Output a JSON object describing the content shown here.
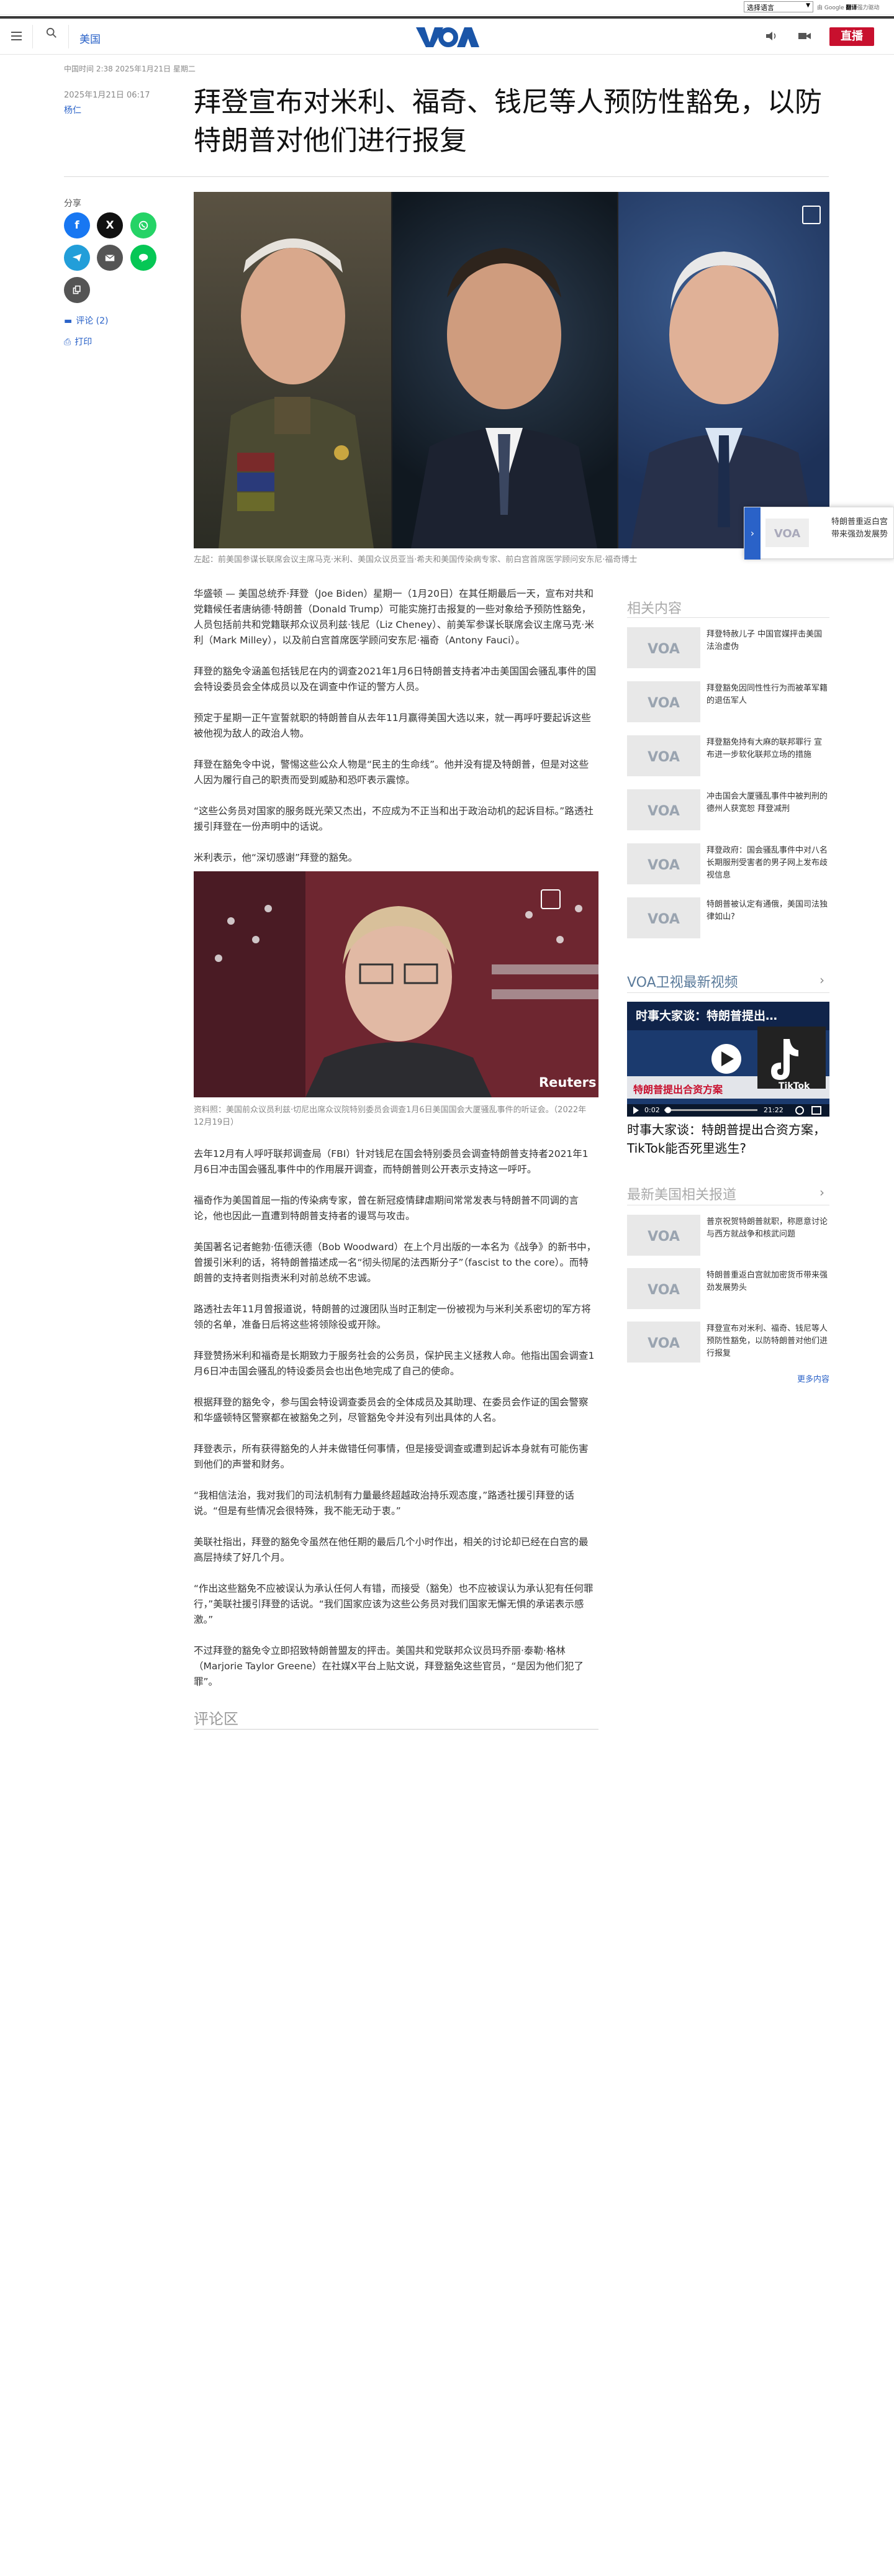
{
  "topbar": {
    "language_select": "选择语言",
    "translate_note_prefix": "由 Google",
    "translate_note_bold": "翻译",
    "translate_note_suffix": "强力驱动"
  },
  "header": {
    "section": "美国",
    "live_label": "直播",
    "logo_text": "VOA"
  },
  "article": {
    "timestamp_line": "中国时间 2:38 2025年1月21日 星期二",
    "date": "2025年1月21日 06:17",
    "author": "杨仁",
    "title": "拜登宣布对米利、福奇、钱尼等人预防性豁免，以防特朗普对他们进行报复",
    "lead_caption": "左起：前美国参谋长联席会议主席马克·米利、美国众议员亚当·希夫和美国传染病专家、前白宫首席医学顾问安东尼·福奇博士",
    "mid_caption": "资料照：美国前众议员利兹·切尼出席众议院特别委员会调查1月6日美国国会大厦骚乱事件的听证会。（2022年12月19日）",
    "mid_watermark": "Reuters",
    "paragraphs_part1": [
      "华盛顿 — 美国总统乔·拜登（Joe Biden）星期一（1月20日）在其任期最后一天，宣布对共和党籍候任者唐纳德·特朗普（Donald Trump）可能实施打击报复的一些对象给予预防性豁免，人员包括前共和党籍联邦众议员利兹·钱尼（Liz Cheney）、前美军参谋长联席会议主席马克·米利（Mark Milley），以及前白宫首席医学顾问安东尼·福奇（Antony Fauci）。",
      "拜登的豁免令涵盖包括钱尼在内的调查2021年1月6日特朗普支持者冲击美国国会骚乱事件的国会特设委员会全体成员以及在调查中作证的警方人员。",
      "预定于星期一正午宣誓就职的特朗普自从去年11月赢得美国大选以来，就一再呼吁要起诉这些被他视为敌人的政治人物。",
      "拜登在豁免令中说，警惕这些公众人物是“民主的生命线”。他并没有提及特朗普，但是对这些人因为履行自己的职责而受到威胁和恐吓表示震惊。",
      "“这些公务员对国家的服务既光荣又杰出，不应成为不正当和出于政治动机的起诉目标。”路透社援引拜登在一份声明中的话说。",
      "米利表示，他“深切感谢”拜登的豁免。"
    ],
    "paragraphs_part2": [
      "去年12月有人呼吁联邦调查局（FBI）针对钱尼在国会特别委员会调查特朗普支持者2021年1月6日冲击国会骚乱事件中的作用展开调查，而特朗普则公开表示支持这一呼吁。",
      "福奇作为美国首屈一指的传染病专家，曾在新冠疫情肆虐期间常常发表与特朗普不同调的言论，他也因此一直遭到特朗普支持者的谩骂与攻击。",
      "美国著名记者鲍勃·伍德沃德（Bob Woodward）在上个月出版的一本名为《战争》的新书中，曾援引米利的话，将特朗普描述成一名“彻头彻尾的法西斯分子”（fascist to the core）。而特朗普的支持者则指责米利对前总统不忠诚。",
      "路透社去年11月曾报道说，特朗普的过渡团队当时正制定一份被视为与米利关系密切的军方将领的名单，准备日后将这些将领除役或开除。",
      "拜登赞扬米利和福奇是长期致力于服务社会的公务员，保护民主义拯救人命。他指出国会调查1月6日冲击国会骚乱的特设委员会也出色地完成了自己的使命。",
      "根据拜登的豁免令，参与国会特设调查委员会的全体成员及其助理、在委员会作证的国会警察和华盛顿特区警察都在被豁免之列，尽管豁免令并没有列出具体的人名。",
      "拜登表示，所有获得豁免的人并未做错任何事情，但是接受调查或遭到起诉本身就有可能伤害到他们的声誉和财务。",
      "“我相信法治，我对我们的司法机制有力量最终超越政治持乐观态度，”路透社援引拜登的话说。“但是有些情况会很特殊，我不能无动于衷。”",
      "美联社指出，拜登的豁免令虽然在他任期的最后几个小时作出，相关的讨论却已经在白宫的最高层持续了好几个月。",
      "“作出这些豁免不应被误认为承认任何人有错，而接受（豁免）也不应被误认为承认犯有任何罪行，”美联社援引拜登的话说。“我们国家应该为这些公务员对我们国家无懈无惧的承诺表示感激。”",
      "不过拜登的豁免令立即招致特朗普盟友的抨击。美国共和党联邦众议员玛乔丽·泰勒·格林（Marjorie Taylor Greene）在社媒X平台上贴文说，拜登豁免这些官员，“是因为他们犯了罪”。"
    ],
    "comment_area": "评论区"
  },
  "sidebar": {
    "share_label": "分享",
    "comments": "评论 (2)",
    "print": "打印"
  },
  "floating_card": {
    "text": "特朗普重返白宫 带来强劲发展势"
  },
  "rail": {
    "related_head": "相关内容",
    "related": [
      "拜登特赦儿子 中国官媒抨击美国法治虚伪",
      "拜登豁免因同性性行为而被革军籍的退伍军人",
      "拜登豁免持有大麻的联邦罪行 宣布进一步软化联邦立场的措施",
      "冲击国会大厦骚乱事件中被判刑的 德州人获宽恕 拜登减刑",
      "拜登政府：国会骚乱事件中对八名长期服刑受害者的男子网上发布歧视信息",
      "特朗普被认定有通俄，美国司法独律如山?"
    ],
    "video_head": "VOA卫视最新视频",
    "video_overlay": "时事大家谈：特朗普提出…",
    "video_caption": "特朗普提出合资方案",
    "video_tiktok": "TikTok",
    "video_time_left": "0:02",
    "video_time_right": "21:22",
    "video_title": "时事大家谈：特朗普提出合资方案，TikTok能否死里逃生?",
    "latest_head": "最新美国相关报道",
    "latest": [
      "普京祝贺特朗普就职，称愿意讨论与西方就战争和核武问题",
      "特朗普重返白宫就加密货币带来强劲发展势头",
      "拜登宣布对米利、福奇、钱尼等人预防性豁免，以防特朗普对他们进行报复"
    ],
    "more": "更多内容"
  }
}
